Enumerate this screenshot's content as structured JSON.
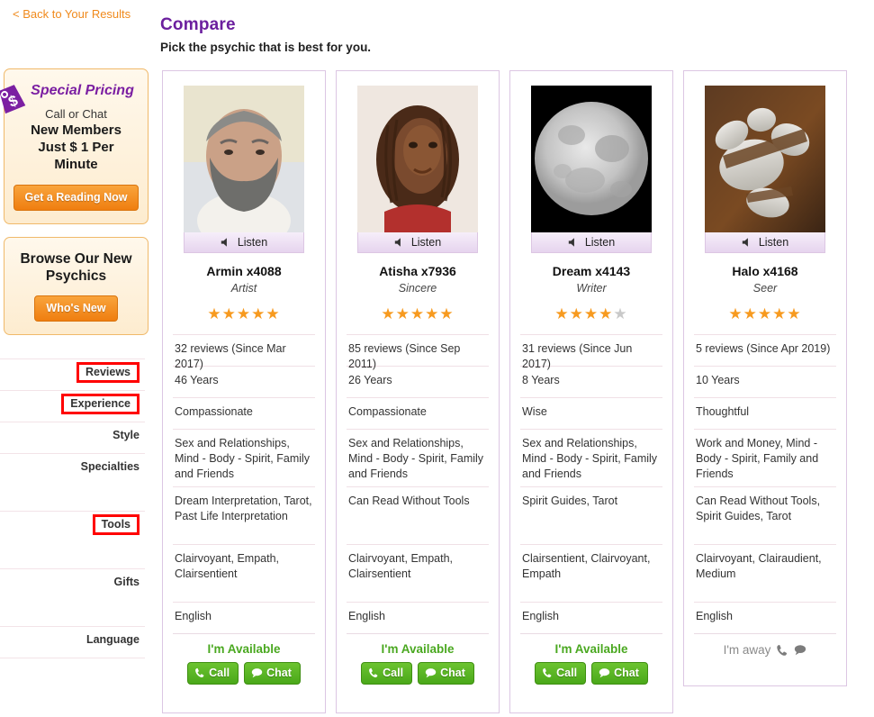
{
  "header": {
    "back_link": "< Back to Your Results",
    "title": "Compare",
    "subtitle": "Pick the psychic that is best for you."
  },
  "colors": {
    "accent_purple": "#6b1f9e",
    "link_orange": "#f08a1c",
    "star_on": "#f79a1f",
    "star_off": "#c9c9c9",
    "available_green": "#4aa820",
    "away_gray": "#8a8a8a",
    "highlight_box": "#ff0000",
    "card_border": "#dcc6e3"
  },
  "promos": [
    {
      "icon": "price-tag-icon",
      "title": "Special Pricing",
      "line1": "Call or Chat",
      "line2": "New Members\nJust $ 1 Per\nMinute",
      "button": "Get a Reading Now"
    },
    {
      "title": "Browse Our New Psychics",
      "button": "Who's New"
    }
  ],
  "row_labels": [
    {
      "label": "Reviews",
      "highlighted": true
    },
    {
      "label": "Experience",
      "highlighted": true
    },
    {
      "label": "Style",
      "highlighted": false
    },
    {
      "label": "Specialties",
      "highlighted": false
    },
    {
      "label": "Tools",
      "highlighted": true
    },
    {
      "label": "Gifts",
      "highlighted": false
    },
    {
      "label": "Language",
      "highlighted": false
    }
  ],
  "listen_label": "Listen",
  "available_label": "I'm Available",
  "away_label": "I'm away",
  "call_label": "Call",
  "chat_label": "Chat",
  "psychics": [
    {
      "name": "Armin x4088",
      "tagline": "Artist",
      "rating": 5,
      "photo": "portrait-bearded-man",
      "reviews": "32 reviews  (Since Mar 2017)",
      "experience": "46 Years",
      "style": "Compassionate",
      "specialties": "Sex and Relationships, Mind - Body - Spirit, Family and Friends",
      "tools": "Dream Interpretation, Tarot, Past Life Interpretation",
      "gifts": "Clairvoyant, Empath, Clairsentient",
      "language": "English",
      "status": "available"
    },
    {
      "name": "Atisha x7936",
      "tagline": "Sincere",
      "rating": 5,
      "photo": "portrait-woman-braids",
      "reviews": "85 reviews  (Since Sep 2011)",
      "experience": "26 Years",
      "style": "Compassionate",
      "specialties": "Sex and Relationships, Mind - Body - Spirit, Family and Friends",
      "tools": "Can Read Without Tools",
      "gifts": "Clairvoyant, Empath, Clairsentient",
      "language": "English",
      "status": "available"
    },
    {
      "name": "Dream x4143",
      "tagline": "Writer",
      "rating": 4,
      "photo": "full-moon",
      "reviews": "31 reviews  (Since Jun 2017)",
      "experience": "8 Years",
      "style": "Wise",
      "specialties": "Sex and Relationships, Mind - Body - Spirit, Family and Friends",
      "tools": "Spirit Guides, Tarot",
      "gifts": "Clairsentient, Clairvoyant, Empath",
      "language": "English",
      "status": "available"
    },
    {
      "name": "Halo x4168",
      "tagline": "Seer",
      "rating": 5,
      "photo": "stacked-stones",
      "reviews": "5 reviews  (Since Apr 2019)",
      "experience": "10 Years",
      "style": "Thoughtful",
      "specialties": "Work and Money, Mind - Body - Spirit, Family and Friends",
      "tools": "Can Read Without Tools, Spirit Guides, Tarot",
      "gifts": "Clairvoyant, Clairaudient, Medium",
      "language": "English",
      "status": "away"
    }
  ]
}
